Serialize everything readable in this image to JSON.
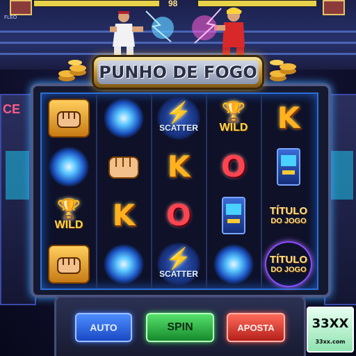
{
  "header": {
    "player_tag": "FLEO",
    "round_counter": "98"
  },
  "title": "PUNHO DE FOGO",
  "reels": [
    [
      "fist",
      "vortex",
      "wild",
      "fist"
    ],
    [
      "vortex",
      "fist",
      "K",
      "vortex"
    ],
    [
      "scatter",
      "K",
      "O",
      "scatter"
    ],
    [
      "wild",
      "O",
      "cabinet",
      "vortex"
    ],
    [
      "K",
      "cabinet",
      "titulo",
      "titulo"
    ]
  ],
  "symbols": {
    "scatter_label": "SCATTER",
    "wild_label": "WILD",
    "letter_k": "K",
    "letter_o": "O",
    "titulo_line1": "TÍTULO",
    "titulo_line2": "DO JOGO"
  },
  "controls": {
    "auto_label": "AUTO",
    "spin_label": "SPIN",
    "aposta_label": "APOSTA"
  },
  "logo": {
    "main": "33XX",
    "sub": "33xx.com"
  },
  "side_cabinets": {
    "left_mark": "CE"
  },
  "colors": {
    "accent_blue": "#2d6fd6",
    "gold": "#ffcb34",
    "spin_green": "#2fbf46",
    "aposta_red": "#d8342a"
  }
}
